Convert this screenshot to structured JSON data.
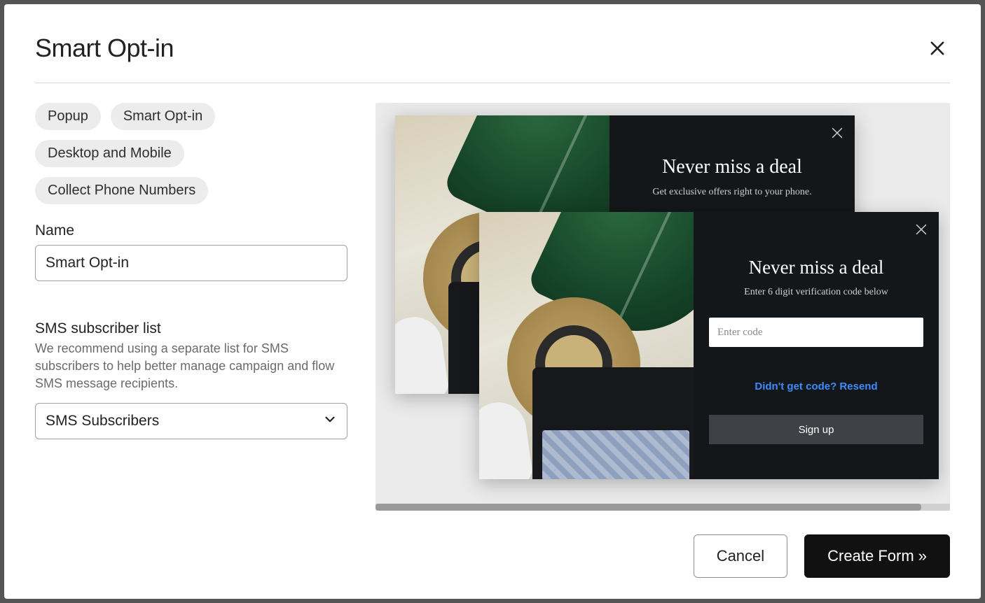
{
  "modal": {
    "title": "Smart Opt-in"
  },
  "chips": [
    "Popup",
    "Smart Opt-in",
    "Desktop and Mobile",
    "Collect Phone Numbers"
  ],
  "name_field": {
    "label": "Name",
    "value": "Smart Opt-in"
  },
  "sms_section": {
    "heading": "SMS subscriber list",
    "description": "We recommend using a separate list for SMS subscribers to help better manage campaign and flow SMS message recipients.",
    "selected": "SMS Subscribers"
  },
  "preview": {
    "back_card": {
      "title": "Never miss a deal",
      "subtitle": "Get exclusive offers right to your phone."
    },
    "front_card": {
      "title": "Never miss a deal",
      "subtitle": "Enter 6 digit verification code below",
      "input_placeholder": "Enter code",
      "resend_text": "Didn't get code? Resend",
      "button_label": "Sign up"
    }
  },
  "footer": {
    "cancel": "Cancel",
    "create": "Create Form »"
  }
}
